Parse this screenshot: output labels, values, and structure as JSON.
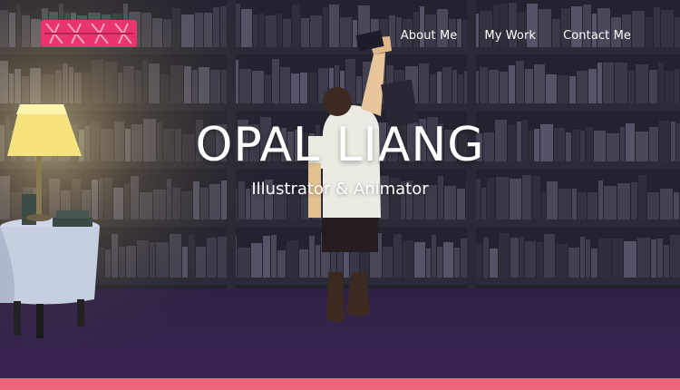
{
  "site": {
    "logo_icon": "op-logo-icon",
    "brand_color": "#e8356d"
  },
  "nav": {
    "items": [
      {
        "label": "About Me"
      },
      {
        "label": "My Work"
      },
      {
        "label": "Contact Me"
      }
    ]
  },
  "hero": {
    "title": "OPAL LIANG",
    "subtitle": "Illustrator & Animator"
  },
  "footer_bar": {
    "color": "#e8687a"
  }
}
